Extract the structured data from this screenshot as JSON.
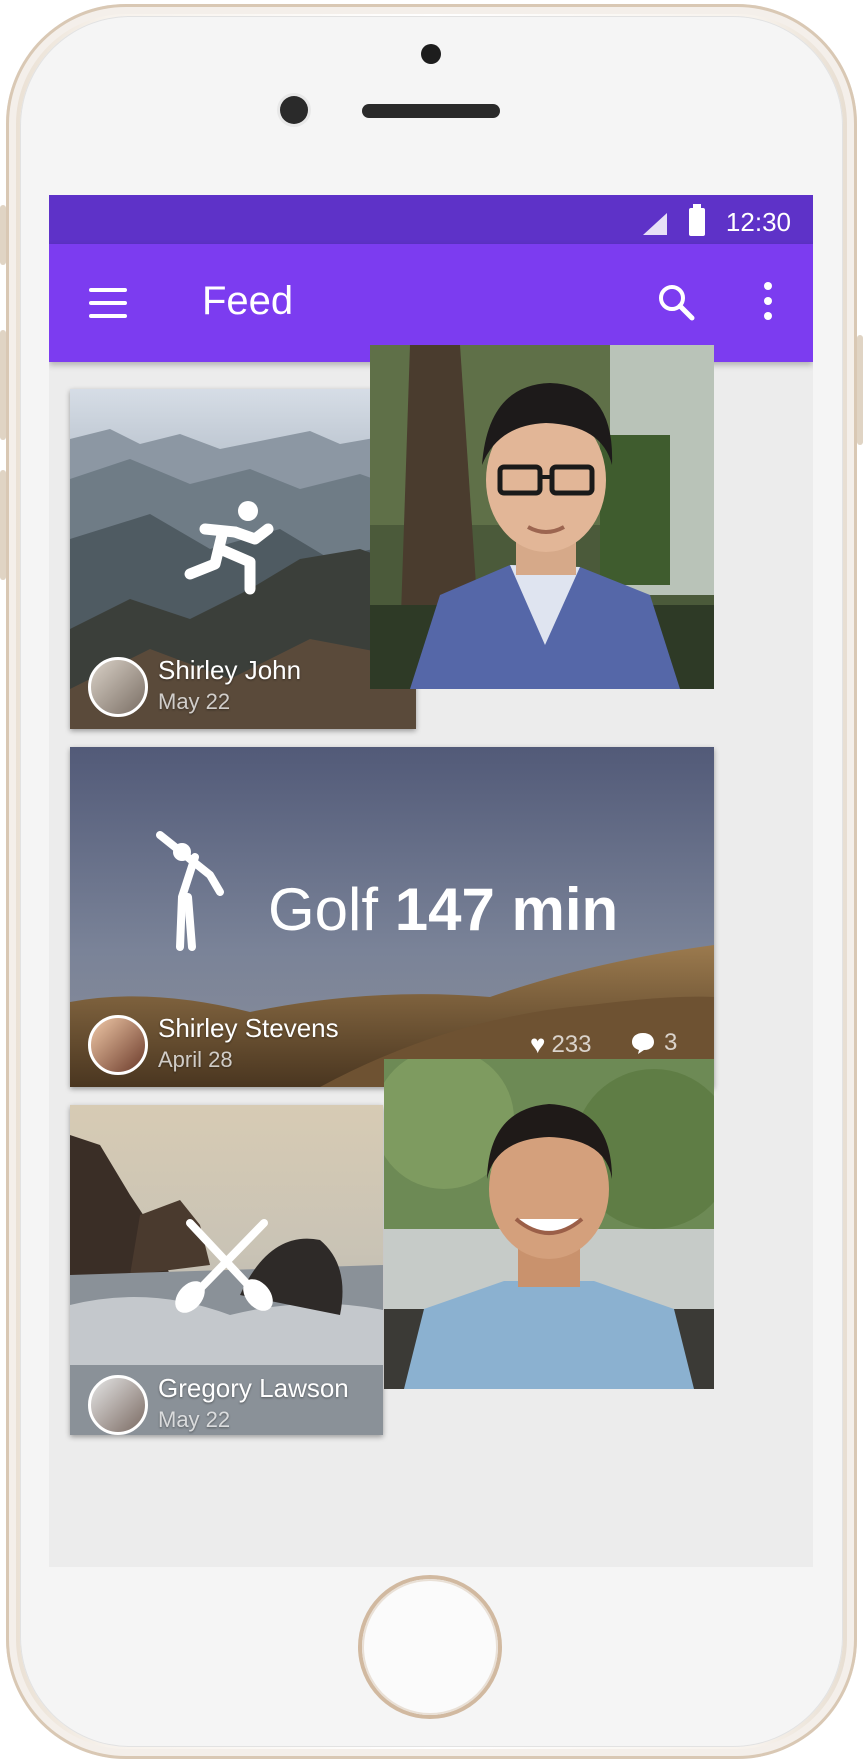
{
  "status_bar": {
    "time": "12:30",
    "signal_icon": "cellular-signal-icon",
    "battery_icon": "battery-icon"
  },
  "app_bar": {
    "title": "Feed",
    "menu_icon": "hamburger-menu-icon",
    "search_icon": "search-icon",
    "more_icon": "more-vertical-icon",
    "color": "#7c3cf0",
    "status_color": "#5e32c8"
  },
  "feed": {
    "card1": {
      "activity_icon": "running-icon",
      "author": "Shirley John",
      "date": "May 22"
    },
    "card2": {
      "activity_icon": "golf-icon",
      "activity": "Golf",
      "duration": "147 min",
      "author": "Shirley Stevens",
      "date": "April 28",
      "likes": "233",
      "comments": "3"
    },
    "card3": {
      "activity_icon": "kayak-paddle-icon",
      "author": "Gregory Lawson",
      "date": "May 22"
    }
  }
}
